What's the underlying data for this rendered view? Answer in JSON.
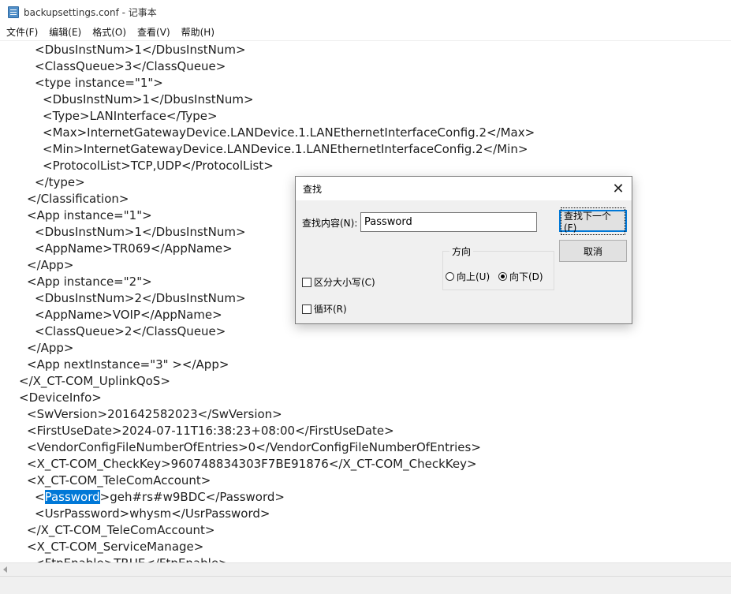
{
  "window": {
    "title": "backupsettings.conf - 记事本"
  },
  "menu": [
    "文件(F)",
    "编辑(E)",
    "格式(O)",
    "查看(V)",
    "帮助(H)"
  ],
  "editor": {
    "lines": [
      {
        "indent": 44,
        "text": "<DbusInstNum>1</DbusInstNum>"
      },
      {
        "indent": 44,
        "text": "<ClassQueue>3</ClassQueue>"
      },
      {
        "indent": 44,
        "text": "<type instance=\"1\">"
      },
      {
        "indent": 54,
        "text": "<DbusInstNum>1</DbusInstNum>"
      },
      {
        "indent": 54,
        "text": "<Type>LANInterface</Type>"
      },
      {
        "indent": 54,
        "text": "<Max>InternetGatewayDevice.LANDevice.1.LANEthernetInterfaceConfig.2</Max>"
      },
      {
        "indent": 54,
        "text": "<Min>InternetGatewayDevice.LANDevice.1.LANEthernetInterfaceConfig.2</Min>"
      },
      {
        "indent": 54,
        "text": "<ProtocolList>TCP,UDP</ProtocolList>"
      },
      {
        "indent": 44,
        "text": "</type>"
      },
      {
        "indent": 34,
        "text": "</Classification>"
      },
      {
        "indent": 34,
        "text": "<App instance=\"1\">"
      },
      {
        "indent": 44,
        "text": "<DbusInstNum>1</DbusInstNum>"
      },
      {
        "indent": 44,
        "text": "<AppName>TR069</AppName>"
      },
      {
        "indent": 34,
        "text": "</App>"
      },
      {
        "indent": 34,
        "text": "<App instance=\"2\">"
      },
      {
        "indent": 44,
        "text": "<DbusInstNum>2</DbusInstNum>"
      },
      {
        "indent": 44,
        "text": "<AppName>VOIP</AppName>"
      },
      {
        "indent": 44,
        "text": "<ClassQueue>2</ClassQueue>"
      },
      {
        "indent": 34,
        "text": "</App>"
      },
      {
        "indent": 34,
        "text": "<App nextInstance=\"3\" ></App>"
      },
      {
        "indent": 24,
        "text": "</X_CT-COM_UplinkQoS>"
      },
      {
        "indent": 24,
        "text": "<DeviceInfo>"
      },
      {
        "indent": 34,
        "text": "<SwVersion>201642582023</SwVersion>"
      },
      {
        "indent": 34,
        "text": "<FirstUseDate>2024-07-11T16:38:23+08:00</FirstUseDate>"
      },
      {
        "indent": 34,
        "text": "<VendorConfigFileNumberOfEntries>0</VendorConfigFileNumberOfEntries>"
      },
      {
        "indent": 34,
        "text": "<X_CT-COM_CheckKey>960748834303F7BE91876</X_CT-COM_CheckKey>"
      },
      {
        "indent": 34,
        "text": "<X_CT-COM_TeleComAccount>"
      },
      {
        "indent": 44,
        "text": "",
        "pre": "<",
        "sel": "Password",
        "post": ">geh#rs#w9BDC</Password>"
      },
      {
        "indent": 44,
        "text": "<UsrPassword>whysm</UsrPassword>"
      },
      {
        "indent": 34,
        "text": "</X_CT-COM_TeleComAccount>"
      },
      {
        "indent": 34,
        "text": "<X_CT-COM_ServiceManage>"
      },
      {
        "indent": 44,
        "text": "<FtpEnable>TRUE</FtpEnable>"
      }
    ]
  },
  "find_dialog": {
    "title": "查找",
    "find_label": "查找内容(N):",
    "find_value": "Password",
    "find_next_label": "查找下一个(F)",
    "cancel_label": "取消",
    "direction_label": "方向",
    "up_label": "向上(U)",
    "down_label": "向下(D)",
    "direction_selected": "down",
    "match_case_label": "区分大小写(C)",
    "match_case_checked": false,
    "wrap_label": "循环(R)",
    "wrap_checked": false
  }
}
